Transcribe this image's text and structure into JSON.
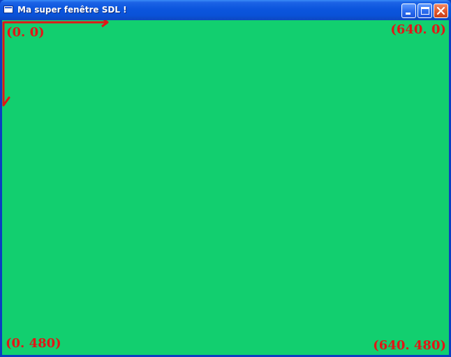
{
  "window": {
    "title": "Ma super fenêtre SDL !",
    "icon": "window-app-icon",
    "controls": [
      "minimize-icon",
      "maximize-icon",
      "close-icon"
    ]
  },
  "canvas": {
    "background_color": "#12cf6f",
    "annotation_color": "#e31515",
    "corner_labels": {
      "top_left": "(0. 0)",
      "top_right": "(640. 0)",
      "bottom_left": "(0. 480)",
      "bottom_right": "(640. 480)"
    }
  },
  "colors": {
    "titlebar": "#0b55dd",
    "frame": "#0a3fc2",
    "close_button": "#e2562b"
  }
}
